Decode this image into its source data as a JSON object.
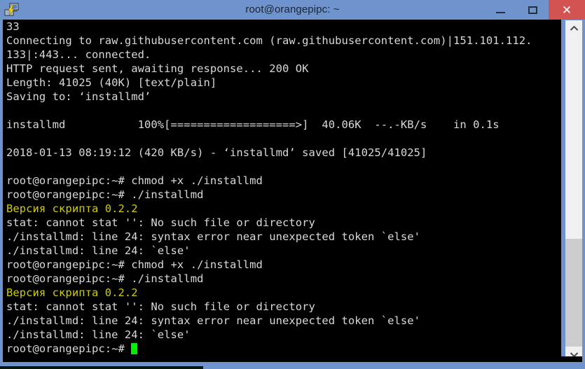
{
  "window": {
    "title": "root@orangepipc: ~",
    "icon": "putty-terminal-icon",
    "accent_color": "#6f94cd",
    "close_button_color": "#d35252",
    "controls": {
      "minimize_label": "–",
      "maximize_label": "□",
      "close_label": "✕"
    }
  },
  "terminal": {
    "background_color": "#000000",
    "foreground_color": "#d8d8d8",
    "highlight_color": "#cdcd00",
    "cursor_color": "#00ee00",
    "lines": [
      {
        "text": "33",
        "color": "white"
      },
      {
        "text": "Connecting to raw.githubusercontent.com (raw.githubusercontent.com)|151.101.112.",
        "color": "white"
      },
      {
        "text": "133|:443... connected.",
        "color": "white"
      },
      {
        "text": "HTTP request sent, awaiting response... 200 OK",
        "color": "white"
      },
      {
        "text": "Length: 41025 (40K) [text/plain]",
        "color": "white"
      },
      {
        "text": "Saving to: ‘installmd’",
        "color": "white"
      },
      {
        "text": "",
        "color": "white"
      },
      {
        "text": "installmd           100%[===================>]  40.06K  --.-KB/s    in 0.1s",
        "color": "white"
      },
      {
        "text": "",
        "color": "white"
      },
      {
        "text": "2018-01-13 08:19:12 (420 KB/s) - ‘installmd’ saved [41025/41025]",
        "color": "white"
      },
      {
        "text": "",
        "color": "white"
      },
      {
        "text": "root@orangepipc:~# chmod +x ./installmd",
        "color": "white"
      },
      {
        "text": "root@orangepipc:~# ./installmd",
        "color": "white"
      },
      {
        "text": "Версия скрипта 0.2.2",
        "color": "yellow"
      },
      {
        "text": "stat: cannot stat '': No such file or directory",
        "color": "white"
      },
      {
        "text": "./installmd: line 24: syntax error near unexpected token `else'",
        "color": "white"
      },
      {
        "text": "./installmd: line 24: `else'",
        "color": "white"
      },
      {
        "text": "root@orangepipc:~# chmod +x ./installmd",
        "color": "white"
      },
      {
        "text": "root@orangepipc:~# ./installmd",
        "color": "white"
      },
      {
        "text": "Версия скрипта 0.2.2",
        "color": "yellow"
      },
      {
        "text": "stat: cannot stat '': No such file or directory",
        "color": "white"
      },
      {
        "text": "./installmd: line 24: syntax error near unexpected token `else'",
        "color": "white"
      },
      {
        "text": "./installmd: line 24: `else'",
        "color": "white"
      }
    ],
    "prompt": "root@orangepipc:~# ",
    "input_value": ""
  },
  "scrollbar": {
    "up_arrow": "chevron-up-icon",
    "down_arrow": "chevron-down-icon",
    "track_color": "#f0f0f0",
    "thumb_color": "#cdcdcd"
  }
}
